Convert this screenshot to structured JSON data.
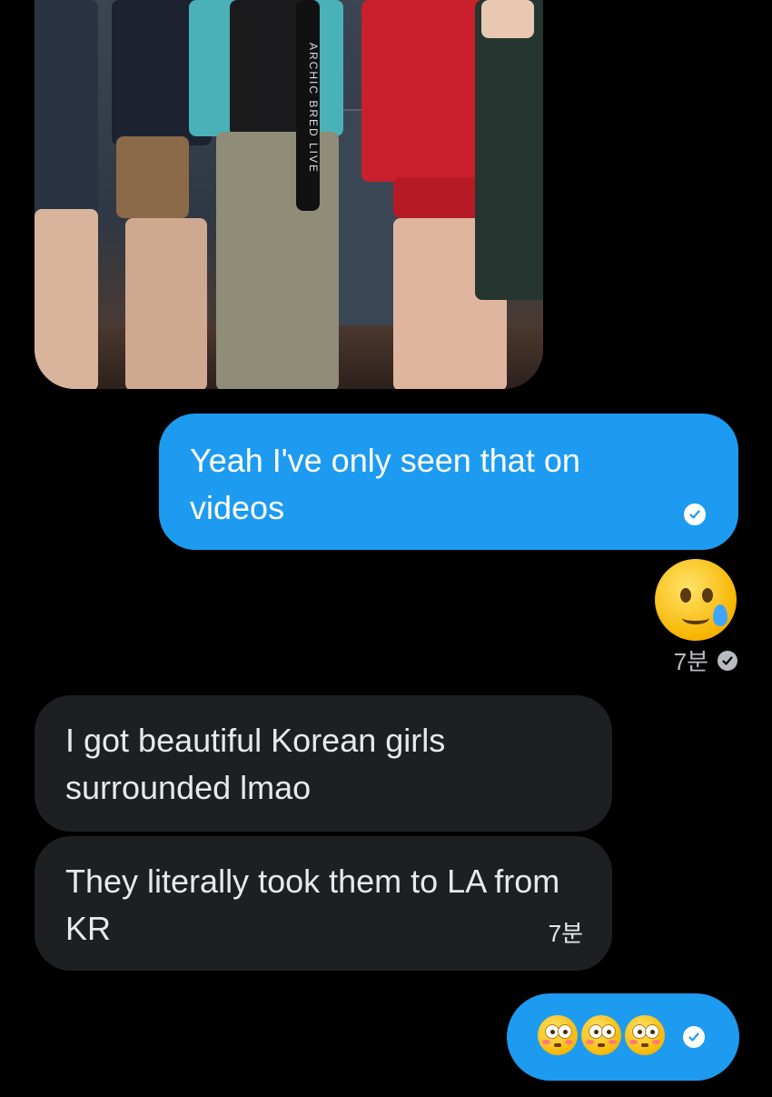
{
  "photo": {
    "lanyard_text": "ARCHIC BRED LIVE",
    "description_icon": "photo-attachment"
  },
  "messages": [
    {
      "id": "m1",
      "direction": "sent",
      "text": "Yeah I've only seen that on videos",
      "status_icon": "read-check-icon"
    },
    {
      "id": "m2",
      "direction": "sent",
      "emoji": "face-holding-back-tears",
      "time": "7분",
      "status_icon": "read-check-icon"
    },
    {
      "id": "m3",
      "direction": "received",
      "text": "I got beautiful Korean girls surrounded lmao"
    },
    {
      "id": "m4",
      "direction": "received",
      "text": "They literally took them to LA from KR",
      "time": "7분"
    },
    {
      "id": "m5",
      "direction": "sent",
      "emoji": "flushed-face x3",
      "status_icon": "read-check-icon"
    }
  ],
  "colors": {
    "background": "#000000",
    "sent_bubble": "#1d9bf0",
    "received_bubble": "#1e1f22",
    "meta_text": "#b8bcc1"
  }
}
